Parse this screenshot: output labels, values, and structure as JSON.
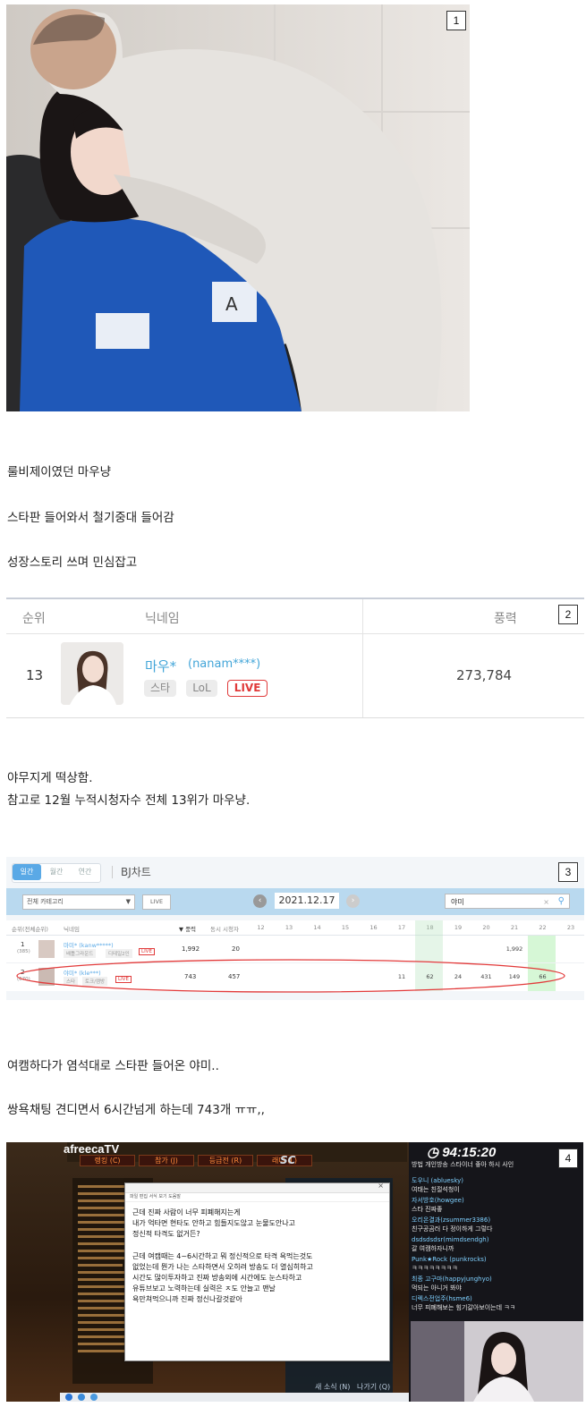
{
  "badges": [
    "1",
    "2",
    "3",
    "4"
  ],
  "paragraphs": {
    "p1": "룰비제이였던 마우냥",
    "p2": "스타판 들어와서 철기중대 들어감",
    "p3": "성장스토리 쓰며 민심잡고",
    "p4": "야무지게 떡상함.",
    "p5": "참고로 12월 누적시청자수 전체 13위가 마우냥.",
    "p6": "여캠하다가 염석대로 스타판 들어온 야미..",
    "p7": "쌍욕채팅 견디면서 6시간넘게 하는데 743개 ㅠㅠ,,"
  },
  "ranking": {
    "headers": {
      "rank": "순위",
      "nickname": "닉네임",
      "power": "풍력"
    },
    "row": {
      "rank": "13",
      "name": "마우*",
      "id": "(nanam****)",
      "tags": [
        "스타",
        "LoL"
      ],
      "live": "LIVE",
      "power": "273,784"
    }
  },
  "bjchart": {
    "tabs": [
      "일간",
      "월간",
      "연간"
    ],
    "title": "BJ차트",
    "category": "전체 카테고리",
    "live_btn": "LIVE",
    "date": "2021.12.17",
    "search": "야미",
    "columns": {
      "rank": "순위(전체순위)",
      "nick": "닉네임",
      "power": "▼ 풍력",
      "viewers": "동시 시청자",
      "hours": [
        "12",
        "13",
        "14",
        "15",
        "16",
        "17",
        "18",
        "19",
        "20",
        "21",
        "22",
        "23"
      ]
    },
    "rows": [
      {
        "rank": "1",
        "sub": "(385)",
        "name": "마미* (kanw*****)",
        "tags": [
          "배틀그라운드",
          "디테일2인"
        ],
        "live": "LIVE",
        "power": "1,992",
        "viewers": "20",
        "hourly": [
          "",
          "",
          "",
          "",
          "",
          "",
          "",
          "",
          "",
          "1,992",
          "",
          ""
        ]
      },
      {
        "rank": "2",
        "sub": "(670)",
        "name": "야미* (kle***)",
        "tags": [
          "스타",
          "토크/캠방"
        ],
        "live": "LIVE",
        "power": "743",
        "viewers": "457",
        "hourly": [
          "",
          "",
          "",
          "",
          "",
          "11",
          "62",
          "24",
          "431",
          "149",
          "66",
          ""
        ]
      }
    ]
  },
  "stream": {
    "logo": "afreecaTV",
    "timer": "94:15:20",
    "menu": [
      "랭킹 (C)",
      "참가 (J)",
      "등급전 (R)",
      "래더 (L)"
    ],
    "notepad_menu": "파일 편집 서식 보기 도움말",
    "notepad_lines": [
      "근데 진짜 사람이 너무 피폐해지는게",
      "내가 억타면 현타도 안하고 힘들지도않고 눈물도안나고",
      "정신적 타격도 없거든?",
      "",
      "근데 여캠때는 4~6시간하고 뭐 정신적으로 타격 욕먹는것도",
      "없었는데 뭔가 나는 스타하면서 오히려 방송도 더 열심히하고",
      "시간도 많이투자하고 진짜 방송외에 시간에도 눈스타하고",
      "유튜브보고 노력하는데 실력은 ㅈ도 안늘고 맨날",
      "욕만쳐먹으니까 진짜 정신나갈것같아"
    ],
    "chat": [
      {
        "name": "",
        "text": "방법 개인방송 스타이너 좋아 하시 사인"
      },
      {
        "name": "도우니 (abluesky)",
        "text": "여태는 친절석청이"
      },
      {
        "name": "자서방호(howgee)",
        "text": "스타 진짜좋"
      },
      {
        "name": "오리온결과(zsummer3386)",
        "text": "친구공곰러 다 정이하게 그렇다"
      },
      {
        "name": "dsdsdsdsr(mimdsendgh)",
        "text": "갈 여캠하자니까"
      },
      {
        "name": "Punk★Rock (punkrocks)",
        "text": "ㅋㅋㅋㅋㅋㅋㅋㅋ"
      },
      {
        "name": "최종 고구마(happyjunghyo)",
        "text": "먹되는 아니거 봐야"
      },
      {
        "name": "디렉스전업주(hsme6)",
        "text": "너무 피폐해보는 힘기갈아보이는데 ㅋㅋ"
      }
    ],
    "bottom_btns": [
      "새 소식 (N)",
      "나가기 (Q)"
    ],
    "channel_label": "SC"
  }
}
